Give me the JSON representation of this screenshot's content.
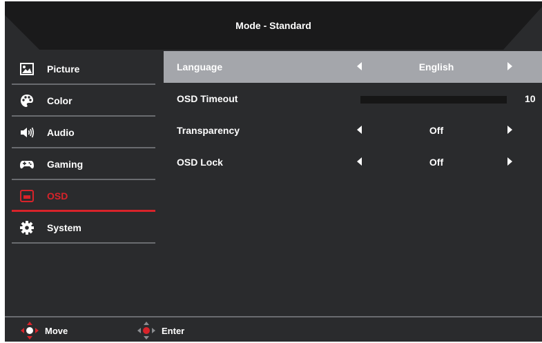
{
  "header": {
    "title": "Mode - Standard"
  },
  "sidebar": {
    "items": [
      {
        "label": "Picture",
        "icon": "picture-icon"
      },
      {
        "label": "Color",
        "icon": "palette-icon"
      },
      {
        "label": "Audio",
        "icon": "speaker-icon"
      },
      {
        "label": "Gaming",
        "icon": "gamepad-icon"
      },
      {
        "label": "OSD",
        "icon": "osd-icon",
        "active": true
      },
      {
        "label": "System",
        "icon": "gear-icon"
      }
    ]
  },
  "settings": {
    "language": {
      "label": "Language",
      "value": "English"
    },
    "osd_timeout": {
      "label": "OSD Timeout",
      "value": "10"
    },
    "transparency": {
      "label": "Transparency",
      "value": "Off"
    },
    "osd_lock": {
      "label": "OSD Lock",
      "value": "Off"
    }
  },
  "footer": {
    "move_label": "Move",
    "enter_label": "Enter"
  },
  "colors": {
    "accent": "#d8232a",
    "panel": "#2a2b2d",
    "highlight": "#a4a6ab"
  }
}
